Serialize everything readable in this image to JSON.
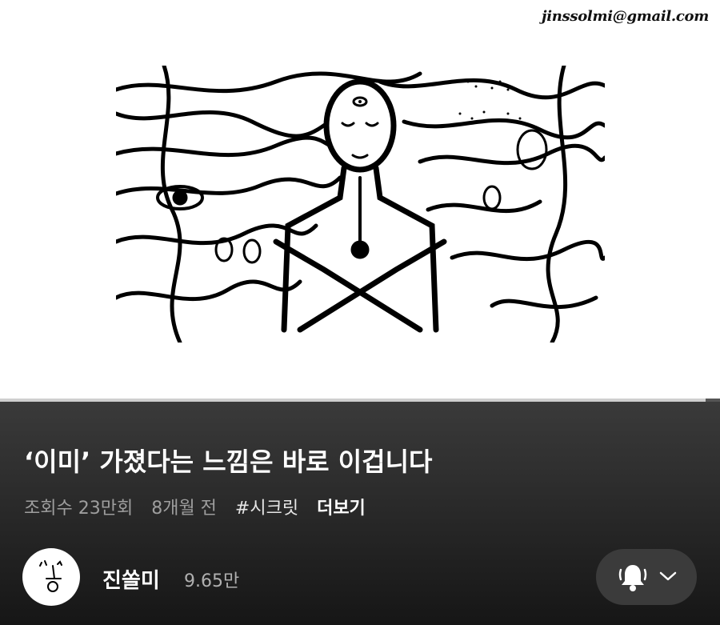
{
  "video": {
    "watermark_email": "jinssolmi@gmail.com",
    "artwork_icon": "mystic-third-eye-illustration",
    "progress": 0.98
  },
  "info": {
    "title": "‘이미’ 가졌다는 느낌은 바로 이겁니다",
    "views": "조회수 23만회",
    "age": "8개월 전",
    "hashtag": "#시크릿",
    "more_label": "더보기"
  },
  "channel": {
    "name": "진쏠미",
    "subscribers": "9.65만",
    "avatar_icon": "handwritten-logo-avatar"
  },
  "subscribe_button": {
    "bell_icon": "bell-ringing-icon",
    "chevron_icon": "chevron-down-icon"
  }
}
